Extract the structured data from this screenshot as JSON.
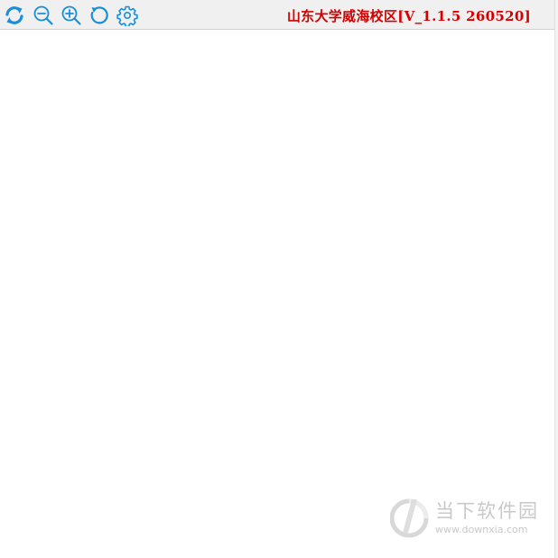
{
  "toolbar": {
    "buttons": [
      {
        "name": "refresh-sync",
        "icon": "refresh-icon"
      },
      {
        "name": "zoom-out",
        "icon": "zoom-out-icon"
      },
      {
        "name": "zoom-in",
        "icon": "zoom-in-icon"
      },
      {
        "name": "rotate",
        "icon": "rotate-icon"
      },
      {
        "name": "settings",
        "icon": "gear-icon"
      }
    ],
    "title": "山东大学威海校区[V_1.1.5 260520]"
  },
  "watermark": {
    "title": "当下软件园",
    "url": "www.downxia.com",
    "icon": "downxia-logo"
  },
  "colors": {
    "title": "#d40000",
    "icon": "#1a8ed6",
    "toolbar_bg": "#f0f0f0",
    "watermark": "#c9c9c9"
  }
}
